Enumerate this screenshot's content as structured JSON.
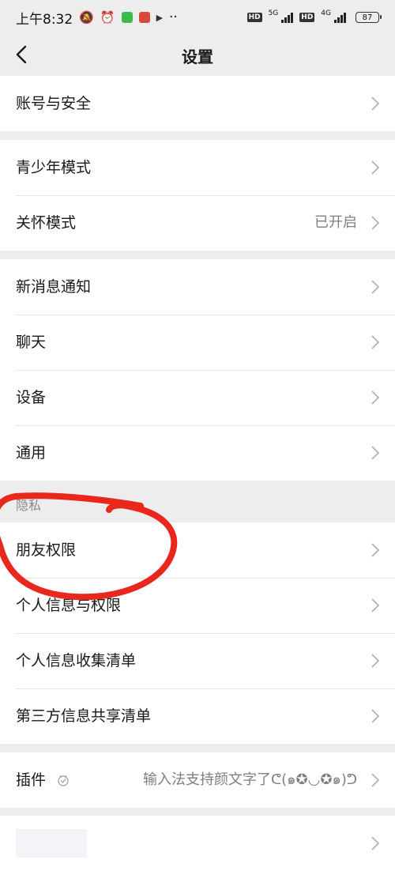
{
  "status_bar": {
    "time": "上午8:32",
    "net1": "5G",
    "net2": "4G",
    "hd": "HD",
    "battery": "87",
    "overflow": "··"
  },
  "nav": {
    "title": "设置"
  },
  "groups": {
    "account": {
      "label": "账号与安全"
    },
    "youth": {
      "label": "青少年模式"
    },
    "care": {
      "label": "关怀模式",
      "value": "已开启"
    },
    "notify": {
      "label": "新消息通知"
    },
    "chat": {
      "label": "聊天"
    },
    "device": {
      "label": "设备"
    },
    "general": {
      "label": "通用"
    },
    "privacy_section": "隐私",
    "friend_perm": {
      "label": "朋友权限"
    },
    "personal_info": {
      "label": "个人信息与权限"
    },
    "info_collect": {
      "label": "个人信息收集清单"
    },
    "third_party": {
      "label": "第三方信息共享清单"
    },
    "plugins": {
      "label": "插件",
      "value": "输入法支持颜文字了ᕦ(๑✪◡✪๑)ᕤ"
    }
  },
  "colors": {
    "annotation": "#e8281d",
    "chevron": "#b2b2b2"
  }
}
